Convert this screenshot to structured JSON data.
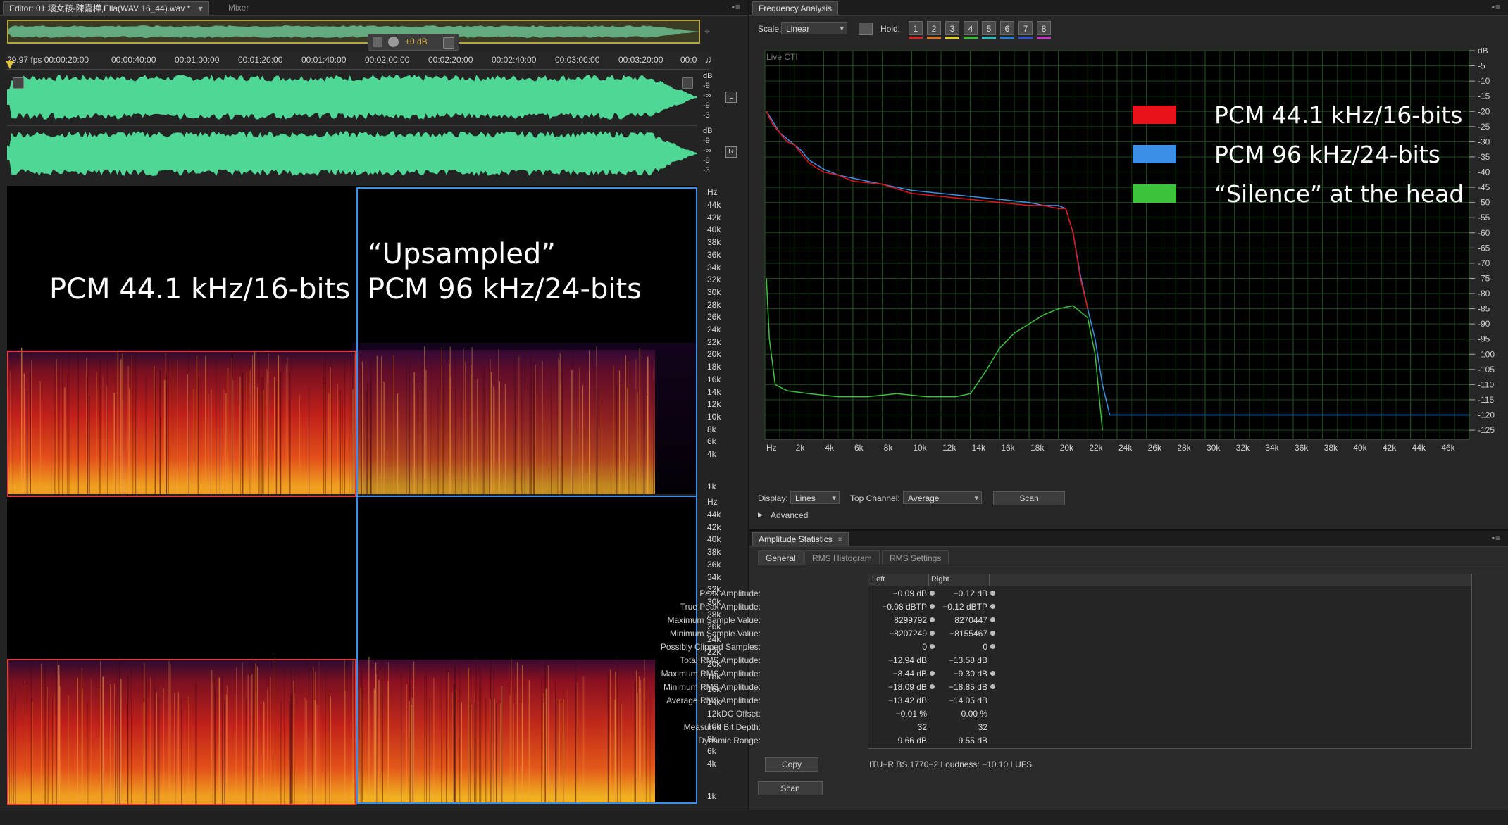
{
  "editor": {
    "tab_label": "Editor: 01 壞女孩-陳嘉樺,Ella(WAV 16_44).wav *",
    "mixer_tab": "Mixer",
    "zoom_db": "+0 dB",
    "timeline": [
      "29.97 fps 00:00:20:00",
      "00:00:40:00",
      "00:01:00:00",
      "00:01:20:00",
      "00:01:40:00",
      "00:02:00:00",
      "00:02:20:00",
      "00:02:40:00",
      "00:03:00:00",
      "00:03:20:00",
      "00:0"
    ],
    "db_scale": [
      "dB",
      "-9",
      "-∞",
      "-9",
      "-3"
    ],
    "channel_left": "L",
    "channel_right": "R",
    "hz_scale": [
      "Hz",
      "44k",
      "42k",
      "40k",
      "38k",
      "36k",
      "34k",
      "32k",
      "30k",
      "28k",
      "26k",
      "24k",
      "22k",
      "20k",
      "18k",
      "16k",
      "14k",
      "12k",
      "10k",
      "8k",
      "6k",
      "4k",
      "1k"
    ],
    "label_left": "PCM 44.1 kHz/16-bits",
    "label_right": "“Upsampled”\nPCM 96 kHz/24-bits",
    "colors": {
      "red_box": "#e23b3b",
      "blue_box": "#3c8fe6",
      "waveform": "#4fd895"
    }
  },
  "freq": {
    "title": "Frequency Analysis",
    "scale_label": "Scale:",
    "scale_value": "Linear",
    "hold_label": "Hold:",
    "hold_buttons": [
      "1",
      "2",
      "3",
      "4",
      "5",
      "6",
      "7",
      "8"
    ],
    "hold_colors": [
      "#e02020",
      "#e07020",
      "#e0d020",
      "#30c030",
      "#20c0c0",
      "#2080e0",
      "#3050e0",
      "#d030d0"
    ],
    "live_cti": "Live CTI",
    "display_label": "Display:",
    "display_value": "Lines",
    "top_channel_label": "Top Channel:",
    "top_channel_value": "Average",
    "scan_button": "Scan",
    "advanced": "Advanced",
    "legend": [
      {
        "label": "PCM 44.1 kHz/16-bits",
        "color": "#e8111a"
      },
      {
        "label": "PCM 96 kHz/24-bits",
        "color": "#3c8fe6"
      },
      {
        "label": "“Silence” at the head",
        "color": "#3cc33c"
      }
    ]
  },
  "chart_data": {
    "type": "line",
    "title": "",
    "xlabel": "",
    "ylabel": "",
    "x_ticks": [
      "Hz",
      "2k",
      "4k",
      "6k",
      "8k",
      "10k",
      "12k",
      "14k",
      "16k",
      "18k",
      "20k",
      "22k",
      "24k",
      "26k",
      "28k",
      "30k",
      "32k",
      "34k",
      "36k",
      "38k",
      "40k",
      "42k",
      "44k",
      "46k"
    ],
    "y_ticks": [
      "dB",
      "-5",
      "-10",
      "-15",
      "-20",
      "-25",
      "-30",
      "-35",
      "-40",
      "-45",
      "-50",
      "-55",
      "-60",
      "-65",
      "-70",
      "-75",
      "-80",
      "-85",
      "-90",
      "-95",
      "-100",
      "-105",
      "-110",
      "-115",
      "-120",
      "-125"
    ],
    "xlim": [
      0,
      48000
    ],
    "ylim": [
      -128,
      0
    ],
    "grid": true,
    "legend_position": "top-right",
    "series": [
      {
        "name": "PCM 44.1 kHz/16-bits",
        "x": [
          100,
          500,
          1000,
          1500,
          2000,
          2500,
          3000,
          4000,
          5000,
          6000,
          8000,
          10000,
          12000,
          14000,
          16000,
          18000,
          19000,
          20000,
          20500,
          21000,
          21500,
          22000
        ],
        "y": [
          -20,
          -24,
          -27,
          -30,
          -31,
          -34,
          -37,
          -40,
          -41,
          -43,
          -44,
          -47,
          -48,
          -49,
          -50,
          -51,
          -51,
          -52,
          -52,
          -60,
          -75,
          -85
        ]
      },
      {
        "name": "PCM 96 kHz/24-bits",
        "x": [
          100,
          500,
          1000,
          1500,
          2000,
          2500,
          3000,
          4000,
          5000,
          6000,
          8000,
          10000,
          12000,
          14000,
          16000,
          18000,
          19000,
          20000,
          20500,
          21000,
          21500,
          22000,
          22500,
          23000,
          23500,
          30000,
          40000,
          48000
        ],
        "y": [
          -20,
          -23,
          -27,
          -29,
          -31,
          -33,
          -36,
          -39,
          -41,
          -42,
          -44,
          -46,
          -47,
          -48,
          -49,
          -50,
          -51,
          -51,
          -52,
          -60,
          -74,
          -85,
          -95,
          -110,
          -120,
          -120,
          -120,
          -120
        ]
      },
      {
        "name": "“Silence” at the head",
        "x": [
          100,
          300,
          700,
          1500,
          3000,
          5000,
          7000,
          9000,
          11000,
          13000,
          14000,
          15000,
          16000,
          17000,
          18000,
          19000,
          20000,
          21000,
          22000,
          22500,
          23000
        ],
        "y": [
          -75,
          -95,
          -110,
          -112,
          -113,
          -114,
          -114,
          -113,
          -114,
          -114,
          -113,
          -106,
          -98,
          -93,
          -90,
          -87,
          -85,
          -84,
          -88,
          -100,
          -125
        ]
      }
    ]
  },
  "amp": {
    "title": "Amplitude Statistics",
    "tabs": [
      "General",
      "RMS Histogram",
      "RMS Settings"
    ],
    "col_left": "Left",
    "col_right": "Right",
    "rows": [
      {
        "label": "Peak Amplitude:",
        "left": "−0.09 dB",
        "right": "−0.12 dB"
      },
      {
        "label": "True Peak Amplitude:",
        "left": "−0.08 dBTP",
        "right": "−0.12 dBTP"
      },
      {
        "label": "Maximum Sample Value:",
        "left": "8299792",
        "right": "8270447"
      },
      {
        "label": "Minimum Sample Value:",
        "left": "−8207249",
        "right": "−8155467"
      },
      {
        "label": "Possibly Clipped Samples:",
        "left": "0",
        "right": "0"
      },
      {
        "label": "Total RMS Amplitude:",
        "left": "−12.94 dB",
        "right": "−13.58 dB"
      },
      {
        "label": "Maximum RMS Amplitude:",
        "left": "−8.44 dB",
        "right": "−9.30 dB"
      },
      {
        "label": "Minimum RMS Amplitude:",
        "left": "−18.09 dB",
        "right": "−18.85 dB"
      },
      {
        "label": "Average RMS Amplitude:",
        "left": "−13.42 dB",
        "right": "−14.05 dB"
      },
      {
        "label": "DC Offset:",
        "left": "−0.01 %",
        "right": "0.00 %"
      },
      {
        "label": "Measured Bit Depth:",
        "left": "32",
        "right": "32"
      },
      {
        "label": "Dynamic Range:",
        "left": "9.66 dB",
        "right": "9.55 dB"
      }
    ],
    "copy_button": "Copy",
    "loudness": "ITU−R BS.1770−2 Loudness: −10.10 LUFS",
    "scan_button": "Scan"
  }
}
